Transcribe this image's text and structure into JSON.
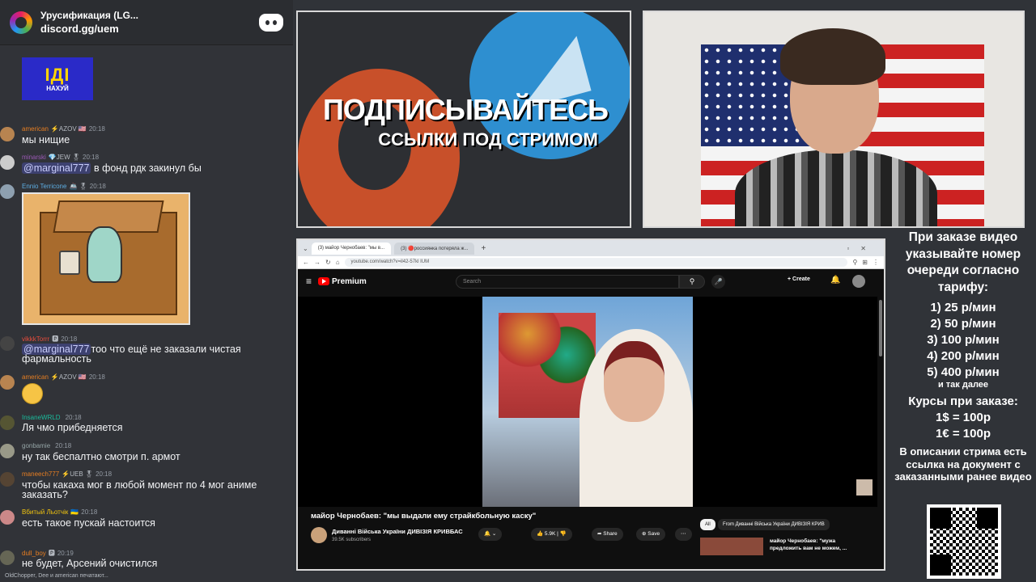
{
  "server": {
    "name": "Урусификация (LG...",
    "link": "discord.gg/uem"
  },
  "banner": {
    "big": "ІДІ",
    "small": "НАХУЙ"
  },
  "messages": [
    {
      "nick": "american",
      "tag": "⚡AZOV 🇺🇸",
      "time": "20:18",
      "text": "мы нищие"
    },
    {
      "nick": "minarski",
      "tag": "💎JEW 🎖",
      "time": "20:18",
      "mention": "@marginal777",
      "text": " в фонд рдк закинул бы"
    },
    {
      "nick": "Ennio Terricone",
      "tag": "🚢 🎖",
      "time": "20:18"
    },
    {
      "nick": "vikkkTorrr",
      "tag": "🅿",
      "time": "20:18",
      "mention": "@marginal777",
      "text": "тоо что ещё не заказали чистая фармальность"
    },
    {
      "nick": "american",
      "tag": "⚡AZOV 🇺🇸",
      "time": "20:18"
    },
    {
      "nick": "InsaneWRLD",
      "tag": "",
      "time": "20:18",
      "text": "Ля чмо прибедняется"
    },
    {
      "nick": "gonbamie",
      "tag": "",
      "time": "20:18",
      "text": "ну так беспалтно смотри п. армот"
    },
    {
      "nick": "maneech777",
      "tag": "⚡UEB 🎖",
      "time": "20:18",
      "text": "чтобы какаха мог в любой момент по 4 мог аниме заказать?"
    },
    {
      "nick": "Вбитый Льотчік",
      "tag": "🇺🇦",
      "time": "20:18",
      "text": "есть такое пускай настоится"
    },
    {
      "nick": "dull_boy",
      "tag": "🅿",
      "time": "20:19",
      "text": "не будет, Арсений очистился"
    }
  ],
  "typing": "OldChopper, Dee и american печатают...",
  "promo": {
    "line1": "ПОДПИСЫВАЙТЕСЬ",
    "line2": "ССЫЛКИ ПОД СТРИМОМ"
  },
  "browser": {
    "tab1": "(3) майор Чернобаев: \"мы в...",
    "tab2": "(3) 🔴россиянка потеряла ж...",
    "url": "youtube.com/watch?v=il42-57kl IUM"
  },
  "youtube": {
    "logo": "Premium",
    "search_placeholder": "Search",
    "create": "Create",
    "video_title": "майор Чернобаев: \"мы выдали ему страйкбольную каску\"",
    "channel": "Диванні Війська України ДИВІЗІЯ КРИВБАС",
    "subscribers": "39.5K subscribers",
    "likes": "5.9K",
    "share": "Share",
    "save": "Save",
    "chip_all": "All",
    "chip_from": "From Диванні Війська України ДИВІЗІЯ КРИВ",
    "side_title": "майор Чернобаев: \"мужа предложить вам не можем, ..."
  },
  "info": {
    "heading": "При заказе видео указывайте номер очереди согласно тарифу:",
    "prices": [
      "1) 25 р/мин",
      "2) 50 р/мин",
      "3) 100 р/мин",
      "4) 200 р/мин",
      "5) 400 р/мин"
    ],
    "etc": "и так далее",
    "courses_title": "Курсы при заказе:",
    "course1": "1$ = 100р",
    "course2": "1€ = 100р",
    "desc": "В описании стрима есть ссылка на документ с заказанными ранее видео"
  },
  "colors": {
    "discord_bg": "#313338",
    "youtube_red": "#ff0000",
    "telegram_blue": "#2e8fd0",
    "patreon_orange": "#c8502a"
  }
}
